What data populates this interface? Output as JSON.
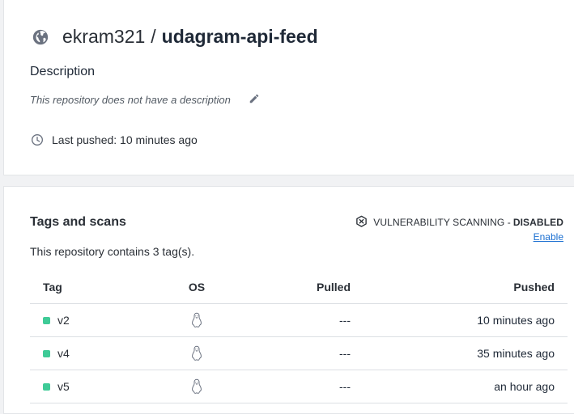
{
  "repo": {
    "owner": "ekram321",
    "separator": "/",
    "name": "udagram-api-feed",
    "visibility_icon": "globe-icon"
  },
  "description": {
    "label": "Description",
    "text": "This repository does not have a description",
    "edit_icon": "pencil-icon"
  },
  "last_pushed": {
    "text": "Last pushed: 10 minutes ago",
    "icon": "clock-icon"
  },
  "tags_section": {
    "title": "Tags and scans",
    "vulnerability": {
      "label": "VULNERABILITY SCANNING -",
      "status": "DISABLED",
      "enable_label": "Enable",
      "icon": "shield-x-icon"
    },
    "count_text": "This repository contains 3 tag(s).",
    "columns": [
      "Tag",
      "OS",
      "Pulled",
      "Pushed"
    ],
    "rows": [
      {
        "tag": "v2",
        "os_icon": "linux-icon",
        "pulled": "---",
        "pushed": "10 minutes ago"
      },
      {
        "tag": "v4",
        "os_icon": "linux-icon",
        "pulled": "---",
        "pushed": "35 minutes ago"
      },
      {
        "tag": "v5",
        "os_icon": "linux-icon",
        "pulled": "---",
        "pushed": "an hour ago"
      }
    ]
  },
  "colors": {
    "tag_dot": "#3fcb97",
    "link": "#1b6fd1",
    "background": "#f1f2f4"
  }
}
